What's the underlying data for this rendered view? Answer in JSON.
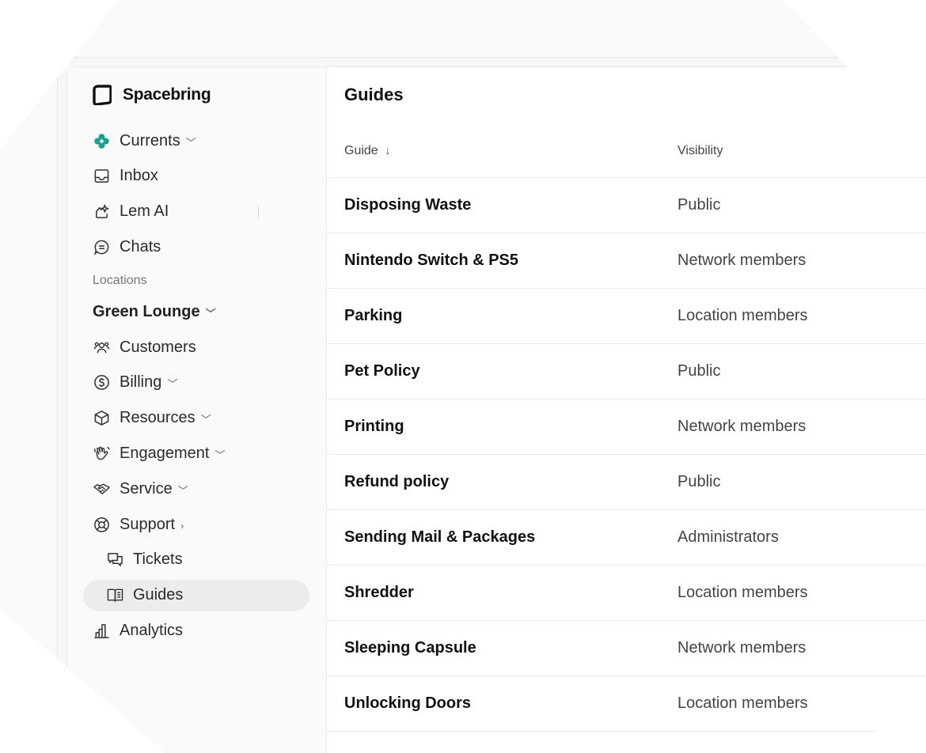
{
  "app": {
    "name": "Spacebring"
  },
  "nav": {
    "top": [
      {
        "label": "Currents",
        "icon": "currents-icon"
      },
      {
        "label": "Inbox",
        "icon": "inbox-icon"
      },
      {
        "label": "Lem AI",
        "icon": "lem-ai-icon"
      },
      {
        "label": "Chats",
        "icon": "chat-icon"
      }
    ],
    "locations_label": "Locations",
    "location": "Green Lounge",
    "items": [
      {
        "label": "Customers",
        "icon": "customers-icon"
      },
      {
        "label": "Billing",
        "icon": "billing-icon"
      },
      {
        "label": "Resources",
        "icon": "resources-icon"
      },
      {
        "label": "Engagement",
        "icon": "engagement-icon"
      },
      {
        "label": "Service",
        "icon": "service-icon"
      },
      {
        "label": "Support",
        "icon": "support-icon"
      },
      {
        "label": "Tickets",
        "icon": "tickets-icon"
      },
      {
        "label": "Guides",
        "icon": "guides-icon",
        "active": true
      },
      {
        "label": "Analytics",
        "icon": "analytics-icon"
      }
    ]
  },
  "main": {
    "title": "Guides",
    "columns": {
      "guide": "Guide",
      "visibility": "Visibility"
    },
    "rows": [
      {
        "guide": "Disposing Waste",
        "visibility": "Public"
      },
      {
        "guide": "Nintendo Switch & PS5",
        "visibility": "Network members"
      },
      {
        "guide": "Parking",
        "visibility": "Location members"
      },
      {
        "guide": "Pet Policy",
        "visibility": "Public"
      },
      {
        "guide": "Printing",
        "visibility": "Network members"
      },
      {
        "guide": "Refund policy",
        "visibility": "Public"
      },
      {
        "guide": "Sending Mail & Packages",
        "visibility": "Administrators"
      },
      {
        "guide": "Shredder",
        "visibility": "Location members"
      },
      {
        "guide": "Sleeping Capsule",
        "visibility": "Network members"
      },
      {
        "guide": "Unlocking Doors",
        "visibility": "Location members"
      }
    ]
  },
  "colors": {
    "accent": "#1aa08f",
    "active_bg": "#ececec"
  }
}
